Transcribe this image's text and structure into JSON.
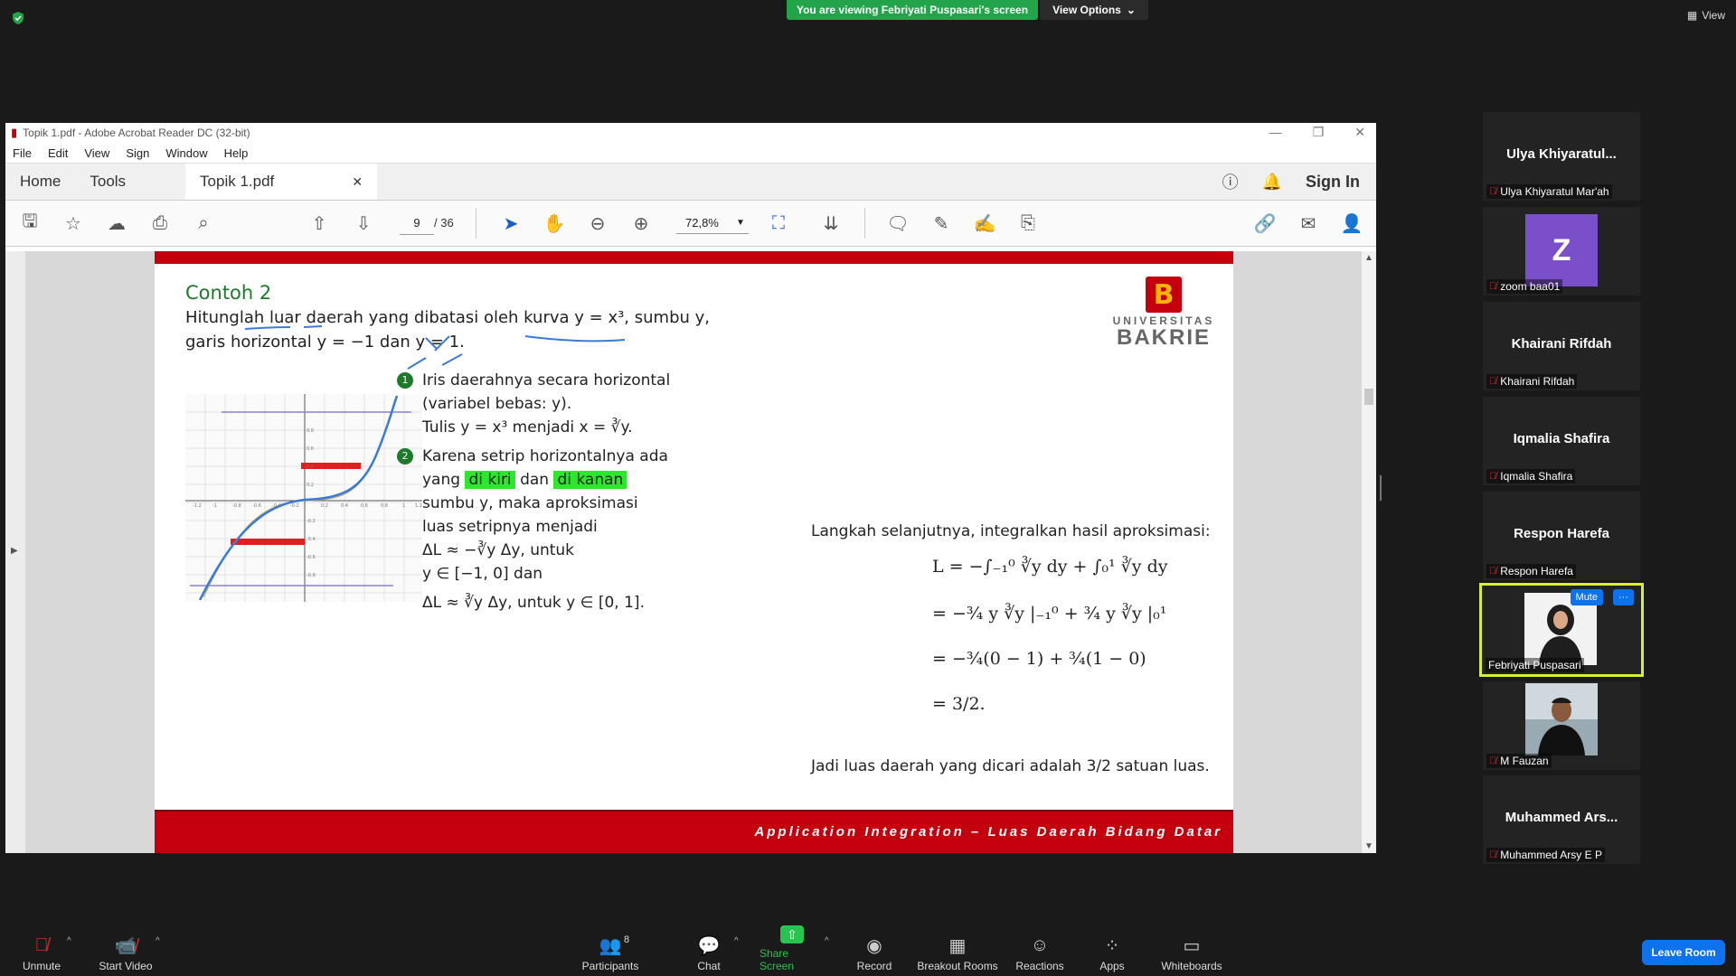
{
  "zoom_meeting": {
    "viewing_banner": "You are viewing Febriyati Puspasari's screen",
    "view_options": "View Options",
    "view_button": "View"
  },
  "acrobat": {
    "window_title": "Topik 1.pdf - Adobe Acrobat Reader DC (32-bit)",
    "menu": [
      "File",
      "Edit",
      "View",
      "Sign",
      "Window",
      "Help"
    ],
    "tab_home": "Home",
    "tab_tools": "Tools",
    "doc_tab": "Topik 1.pdf",
    "sign_in": "Sign In",
    "page_current": "9",
    "page_total": "/ 36",
    "zoom": "72,8%"
  },
  "slide": {
    "title": "Contoh 2",
    "question_line1": "Hitunglah luar daerah yang dibatasi oleh kurva y = x³, sumbu y,",
    "question_line2": "garis horizontal y = −1 dan y = 1.",
    "logo_letter": "B",
    "logo_univ": "UNIVERSITAS",
    "logo_name": "BAKRIE",
    "step1_num": "1",
    "step1_line1": "Iris daerahnya secara horizontal",
    "step1_line2": "(variabel bebas: y).",
    "step1_line3": "Tulis y = x³ menjadi x = ∛y.",
    "step2_num": "2",
    "step2_line1": "Karena setrip horizontalnya ada",
    "step2_yang": "yang",
    "step2_left": "di kiri",
    "step2_dan": "dan",
    "step2_right": "di kanan",
    "step2_line3": "sumbu y, maka aproksimasi",
    "step2_line4": "luas setripnya menjadi",
    "step2_line5": "ΔL ≈ −∛y Δy, untuk",
    "step2_line6": "y ∈ [−1, 0] dan",
    "step2_line7": "ΔL ≈ ∛y Δy, untuk y ∈ [0, 1].",
    "next_step": "Langkah selanjutnya, integralkan hasil aproksimasi:",
    "eq1": "L  =  −∫₋₁⁰ ∛y dy + ∫₀¹ ∛y dy",
    "eq2": "   =  −¾ y ∛y |₋₁⁰ + ¾ y ∛y |₀¹",
    "eq3": "   =  −¾(0 − 1) + ¾(1 − 0)",
    "eq4": "   =  3/2.",
    "conclusion": "Jadi luas daerah yang dicari adalah 3/2 satuan luas.",
    "footer": "Application Integration – Luas Daerah Bidang Datar",
    "graph_x_ticks": [
      "-1.2",
      "-1",
      "-0.8",
      "-0.6",
      "-0.4",
      "-0.2",
      "0.2",
      "0.4",
      "0.6",
      "0.8",
      "1",
      "1.2"
    ],
    "graph_y_ticks": [
      "0.8",
      "0.6",
      "0.4",
      "0.2",
      "-0.2",
      "-0.4",
      "-0.6",
      "-0.8"
    ]
  },
  "participants_tiles": [
    {
      "big": "Ulya  Khiyaratul...",
      "name": "Ulya Khiyaratul Mar'ah"
    },
    {
      "avatar": "Z",
      "name": "zoom baa01"
    },
    {
      "big": "Khairani Rifdah",
      "name": "Khairani Rifdah"
    },
    {
      "big": "Iqmalia Shafira",
      "name": "Iqmalia Shafira"
    },
    {
      "big": "Respon Harefa",
      "name": "Respon Harefa"
    },
    {
      "name": "Febriyati Puspasari",
      "mute": "Mute",
      "more": "···"
    },
    {
      "name": "M Fauzan"
    },
    {
      "big": "Muhammed  Ars...",
      "name": "Muhammed Arsy E P"
    }
  ],
  "toolbar": {
    "unmute": "Unmute",
    "start_video": "Start Video",
    "participants": "Participants",
    "participants_count": "8",
    "chat": "Chat",
    "share_screen": "Share Screen",
    "record": "Record",
    "breakout_rooms": "Breakout Rooms",
    "reactions": "Reactions",
    "apps": "Apps",
    "whiteboards": "Whiteboards",
    "leave_room": "Leave Room"
  },
  "colors": {
    "banner_green": "#23a34a",
    "slide_red": "#c4000e",
    "title_green": "#1c7a2a",
    "highlight_green": "#2ee62e",
    "zoom_blue": "#0e72ed",
    "active_speaker": "#d8ef3a"
  }
}
